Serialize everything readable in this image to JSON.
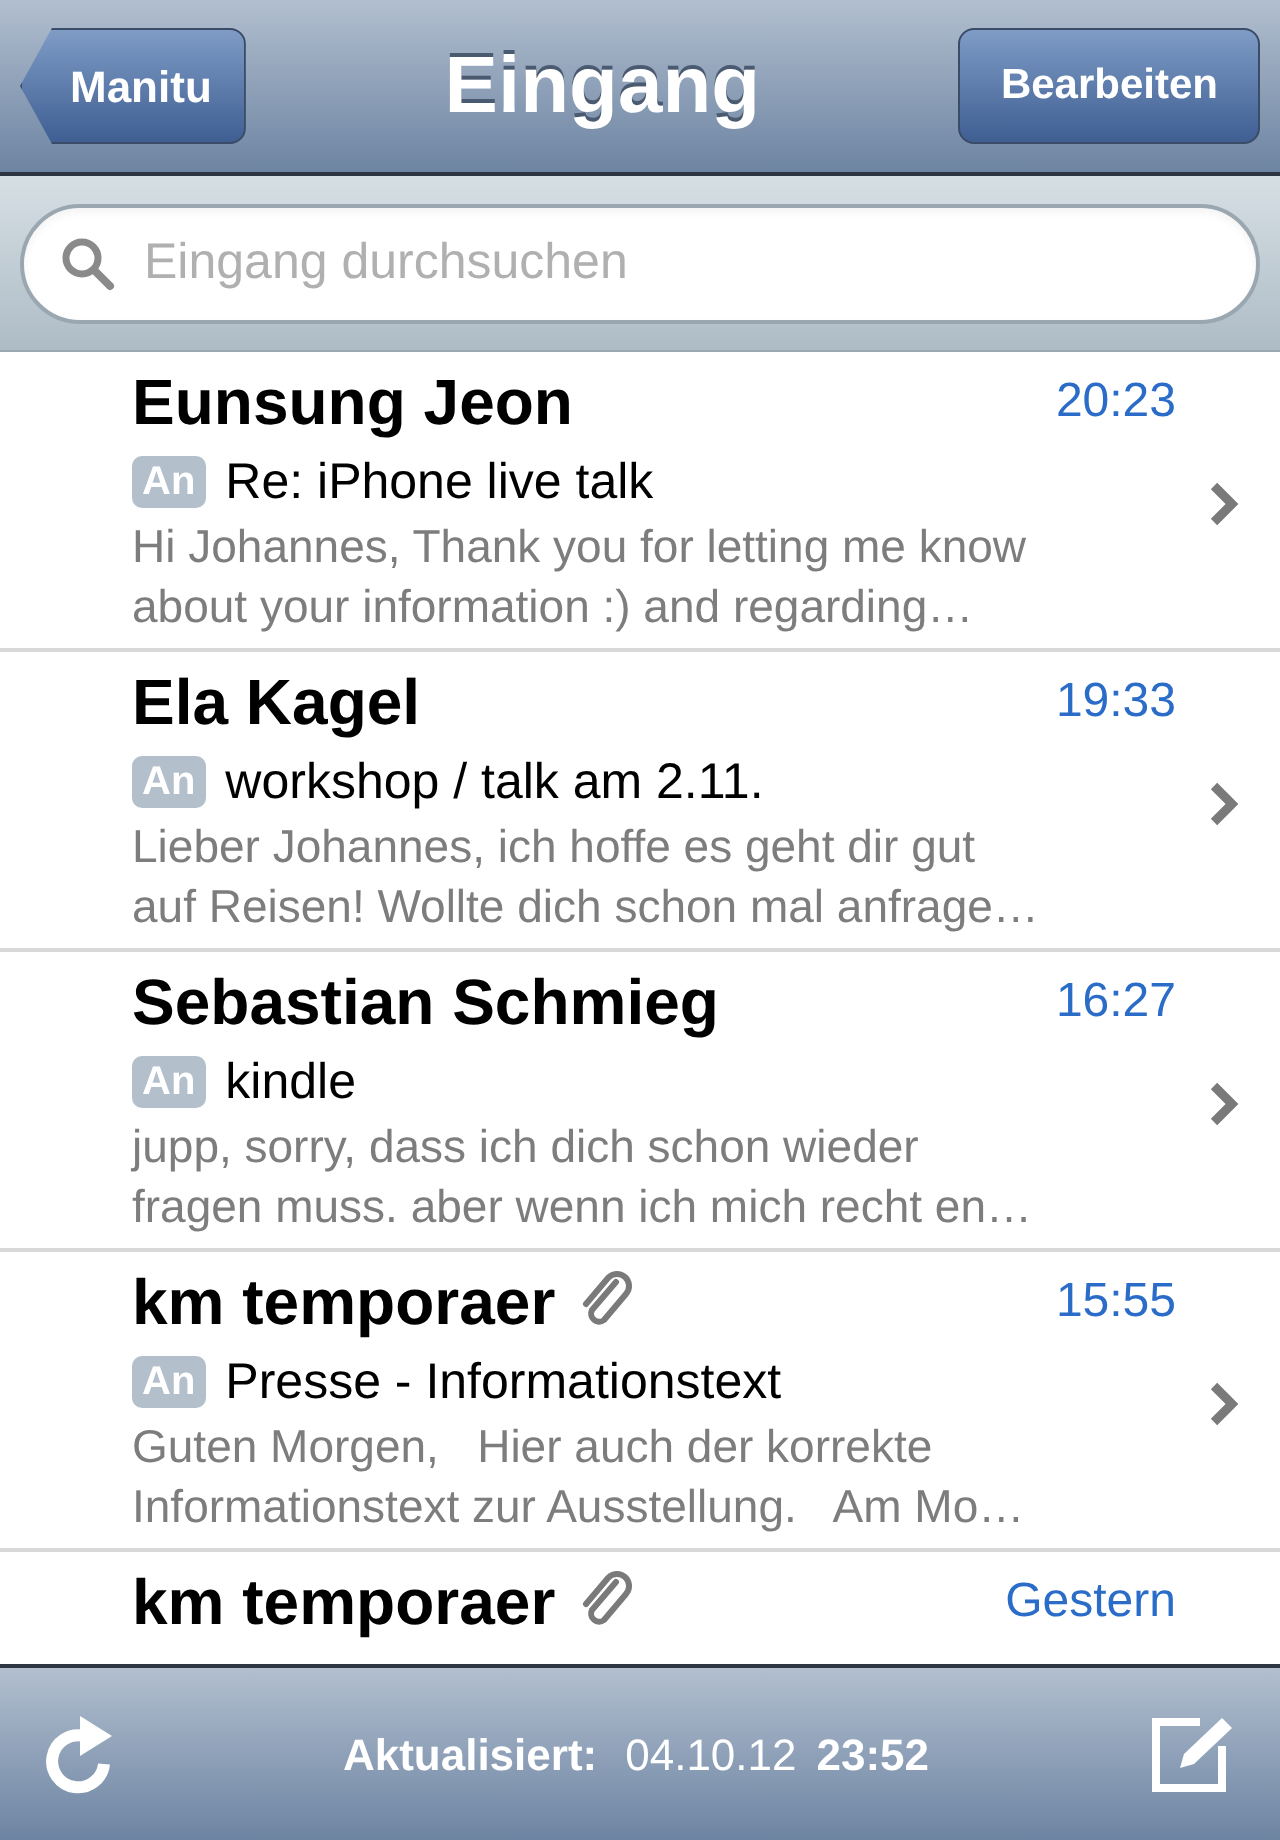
{
  "nav": {
    "back": "Manitu",
    "title": "Eingang",
    "edit": "Bearbeiten"
  },
  "search": {
    "placeholder": "Eingang durchsuchen"
  },
  "messages": [
    {
      "sender": "Eunsung Jeon",
      "time": "20:23",
      "attachment": false,
      "badge": "An",
      "subject": "Re: iPhone live talk",
      "preview_lines": [
        "Hi Johannes, Thank you for letting me know",
        "about your information :) and regarding…"
      ]
    },
    {
      "sender": "Ela Kagel",
      "time": "19:33",
      "attachment": false,
      "badge": "An",
      "subject": "workshop / talk am 2.11.",
      "preview_lines": [
        "Lieber Johannes, ich hoffe es geht dir gut",
        "auf Reisen! Wollte dich schon mal anfrage…"
      ]
    },
    {
      "sender": "Sebastian Schmieg",
      "time": "16:27",
      "attachment": false,
      "badge": "An",
      "subject": "kindle",
      "preview_lines": [
        "jupp, sorry, dass ich dich schon wieder",
        "fragen muss. aber wenn ich mich recht en…"
      ]
    },
    {
      "sender": "km temporaer",
      "time": "15:55",
      "attachment": true,
      "badge": "An",
      "subject": "Presse - Informationstext",
      "preview_lines": [
        "Guten Morgen,   Hier auch der korrekte",
        "Informationstext zur Ausstellung.   Am Mo…"
      ]
    },
    {
      "sender": "km temporaer",
      "time": "Gestern",
      "attachment": true
    }
  ],
  "toolbar": {
    "label": "Aktualisiert:",
    "date": "04.10.12",
    "time": "23:52"
  }
}
